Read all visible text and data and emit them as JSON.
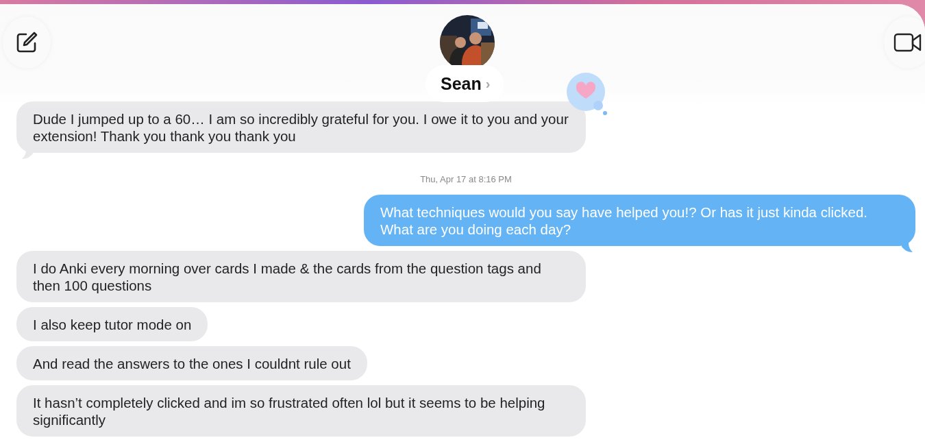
{
  "header": {
    "contact_name": "Sean",
    "chevron": "›"
  },
  "messages": [
    {
      "kind": "received",
      "text": "Dude I jumped up to a 60… I am so incredibly grateful for you. I owe it to you and your extension! Thank you thank you thank you",
      "tail": true,
      "hearted": true
    },
    {
      "kind": "timestamp",
      "text": "Thu, Apr 17 at 8:16 PM"
    },
    {
      "kind": "sent",
      "text": "What techniques would you say have helped you!? Or has it just kinda clicked. What are you doing each day?",
      "tail": true,
      "hearted": false
    },
    {
      "kind": "received",
      "text": "I do Anki every morning over cards I made & the cards from the question tags and then 100 questions",
      "tail": false,
      "hearted": false
    },
    {
      "kind": "received",
      "text": "I also keep tutor mode on",
      "tail": false,
      "hearted": false
    },
    {
      "kind": "received",
      "text": "And read the answers to the ones I couldnt rule out",
      "tail": false,
      "hearted": false
    },
    {
      "kind": "received",
      "text": "It hasn’t completely clicked and im so frustrated often lol but it seems to be helping significantly",
      "tail": false,
      "hearted": false
    }
  ]
}
